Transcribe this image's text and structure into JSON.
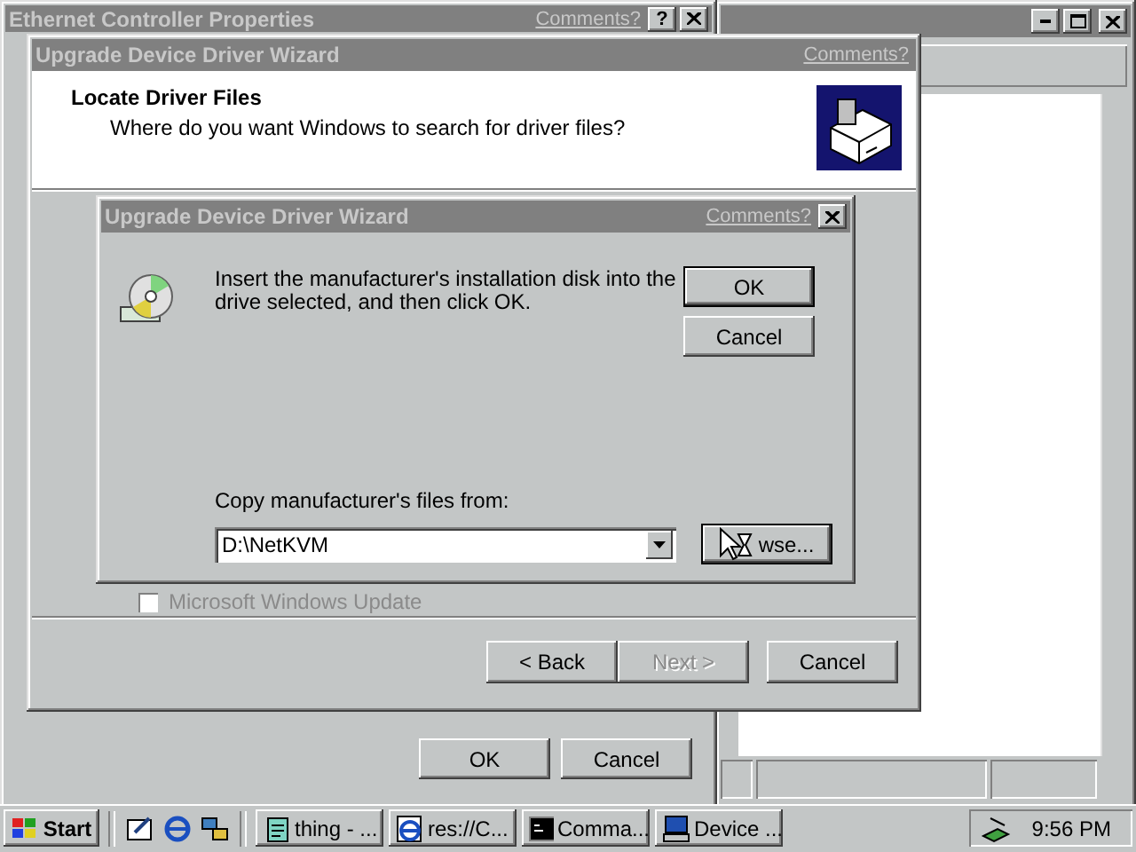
{
  "properties_window": {
    "title": "Ethernet Controller Properties",
    "comments_link": "Comments?",
    "help_button": "?",
    "buttons": [
      "OK",
      "Cancel"
    ]
  },
  "wizard": {
    "title": "Upgrade Device Driver Wizard",
    "comments_link": "Comments?",
    "heading": "Locate Driver Files",
    "subheading": "Where do you want Windows to search for driver files?",
    "checkbox": {
      "label": "Microsoft Windows Update",
      "checked": false
    },
    "buttons": [
      {
        "label": "< Back",
        "disabled": false
      },
      {
        "label": "Next >",
        "disabled": true
      },
      {
        "label": "Cancel",
        "disabled": false
      }
    ]
  },
  "dialog": {
    "title": "Upgrade Device Driver Wizard",
    "comments_link": "Comments?",
    "message": "Insert the manufacturer's installation disk into the drive selected, and then click OK.",
    "buttons": [
      "OK",
      "Cancel"
    ],
    "copy_label": "Copy manufacturer's files from:",
    "path_value": "D:\\NetKVM",
    "browse_button": "wse..."
  },
  "taskbar": {
    "start": "Start",
    "tasks": [
      {
        "label": "thing - ...",
        "kind": "notepad",
        "selected": false
      },
      {
        "label": "res://C...",
        "kind": "browser",
        "selected": false
      },
      {
        "label": "Comma...",
        "kind": "console",
        "selected": false
      },
      {
        "label": "Device ...",
        "kind": "computer",
        "selected": false
      }
    ],
    "clock": "9:56 PM"
  }
}
